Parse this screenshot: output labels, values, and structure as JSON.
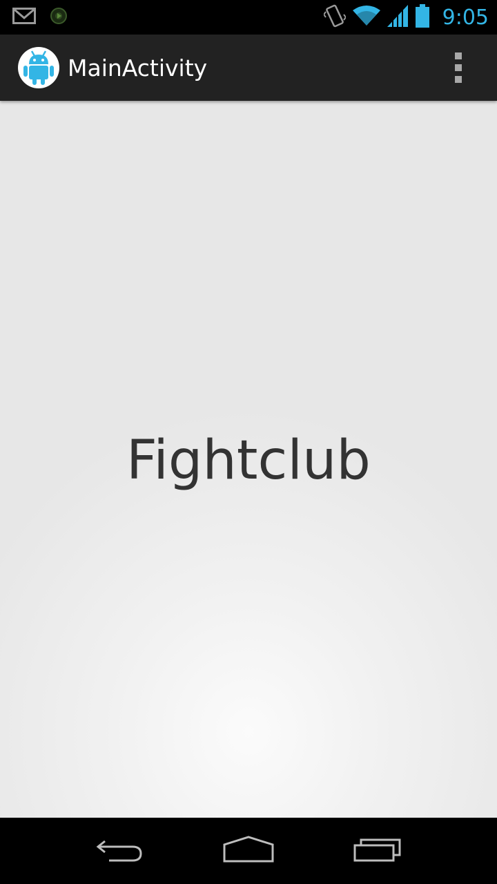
{
  "status_bar": {
    "time": "9:05",
    "icons": [
      "gmail-icon",
      "media-player-icon",
      "vibrate-icon",
      "wifi-icon",
      "signal-icon",
      "battery-icon"
    ],
    "accent_color": "#33b5e5"
  },
  "action_bar": {
    "title": "MainActivity",
    "app_icon": "android-robot-icon",
    "overflow_icon": "overflow-menu-icon"
  },
  "main": {
    "text": "Fightclub"
  },
  "nav_bar": {
    "buttons": [
      "back-icon",
      "home-icon",
      "recent-apps-icon"
    ]
  }
}
